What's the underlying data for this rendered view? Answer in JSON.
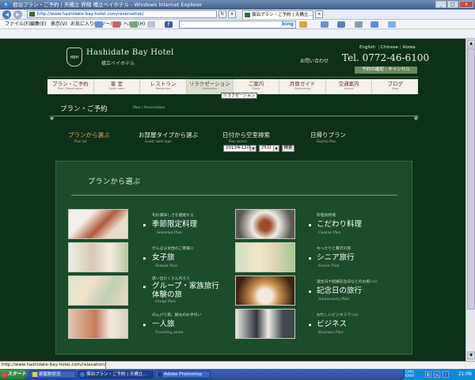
{
  "window": {
    "title": "宿泊プラン・ご予約 | 天橋立 界隈 橋立ベイホテル - Windows Internet Explorer",
    "minimize": "_",
    "maximize": "□",
    "close": "x"
  },
  "browser": {
    "back": "◀",
    "forward": "▶",
    "url": "http://www.hashidate-bay-hotel.com/reservation/",
    "tab_title": "宿泊プラン・ご予約 | 天橋立…",
    "search_logo": "bing",
    "menu": [
      "ファイル(F)",
      "編集(E)",
      "表示(V)",
      "お気に入り(A)",
      "ツール(T)",
      "ヘルプ(H)"
    ]
  },
  "site": {
    "crest": "HBH",
    "logo_name": "Hashidate Bay Hotel",
    "logo_jp": "橋立ベイホテル",
    "languages": [
      "English",
      "Chinese",
      "Korea"
    ],
    "contact": "お問い合わせ",
    "tel": "Tel. 0772-46-6100",
    "reservation_button": "予約の確認・キャンセル",
    "nav": [
      {
        "jp": "プラン・ご予約",
        "en": "Plan / Reservation"
      },
      {
        "jp": "客 室",
        "en": "Guest room"
      },
      {
        "jp": "レストラン",
        "en": "Restaurant"
      },
      {
        "jp": "リラクゼーション",
        "en": "Relaxation"
      },
      {
        "jp": "ご案内",
        "en": "Guide"
      },
      {
        "jp": "月替ガイド",
        "en": "Sightseeing"
      },
      {
        "jp": "交通案内",
        "en": "Access"
      },
      {
        "jp": "ブログ",
        "en": "Blog"
      }
    ],
    "tooltip": "リラクゼーション"
  },
  "page": {
    "title": "プラン・ご予約",
    "subtitle": "Plan / Reservation",
    "steps": [
      {
        "jp": "プランから選ぶ",
        "en": "Plan list"
      },
      {
        "jp": "お部屋タイプから選ぶ",
        "en": "Guest room type"
      },
      {
        "jp": "日付から空室検索",
        "en": "Plan search"
      },
      {
        "jp": "日帰りプラン",
        "en": "Daytrip Plan"
      }
    ],
    "month_select": "2013年12月",
    "day_select": "25日",
    "search_button": "検索",
    "panel_title": "プランから選ぶ"
  },
  "plans": [
    {
      "small": "旬の美味しさを堪能する",
      "name": "季節限定料理",
      "en": "Seasonal Plan"
    },
    {
      "small": "料理長特選",
      "name": "こだわり料理",
      "en": "Cuisine Plan"
    },
    {
      "small": "がんばる女性のご褒美に",
      "name": "女子旅",
      "en": "Female Plan"
    },
    {
      "small": "ゆったりと贅沢の旅",
      "name": "シニア旅行",
      "en": "Senior Plan"
    },
    {
      "small": "思い出たくさん作ろう",
      "name": "グループ・家族旅行\n体験の旅",
      "en": "Group Plan"
    },
    {
      "small": "誕生日や結婚記念日などのお祝いに",
      "name": "記念日の旅行",
      "en": "Anniversary Plan"
    },
    {
      "small": "のんびり旅。観光のお手伝い",
      "name": "一人旅",
      "en": "Traveling alone"
    },
    {
      "small": "お忙しいビジネスマンに",
      "name": "ビジネス",
      "en": "Business Plan"
    }
  ],
  "status": {
    "link": "http://www.hashidate-bay-hotel.com/relaxation/"
  },
  "taskbar": {
    "start": "スタート",
    "items": [
      "部屋割状況",
      "宿泊プラン・ご予約 | 天橋立…",
      "Adobe Photoshop"
    ],
    "ime": "CAPS KANA",
    "time": "21:06"
  },
  "colors": {
    "site_bg": "#0c3018",
    "panel_bg": "#1a4d2a",
    "accent_orange": "#f0a84a",
    "nav_bg": "#f4f2ea"
  }
}
